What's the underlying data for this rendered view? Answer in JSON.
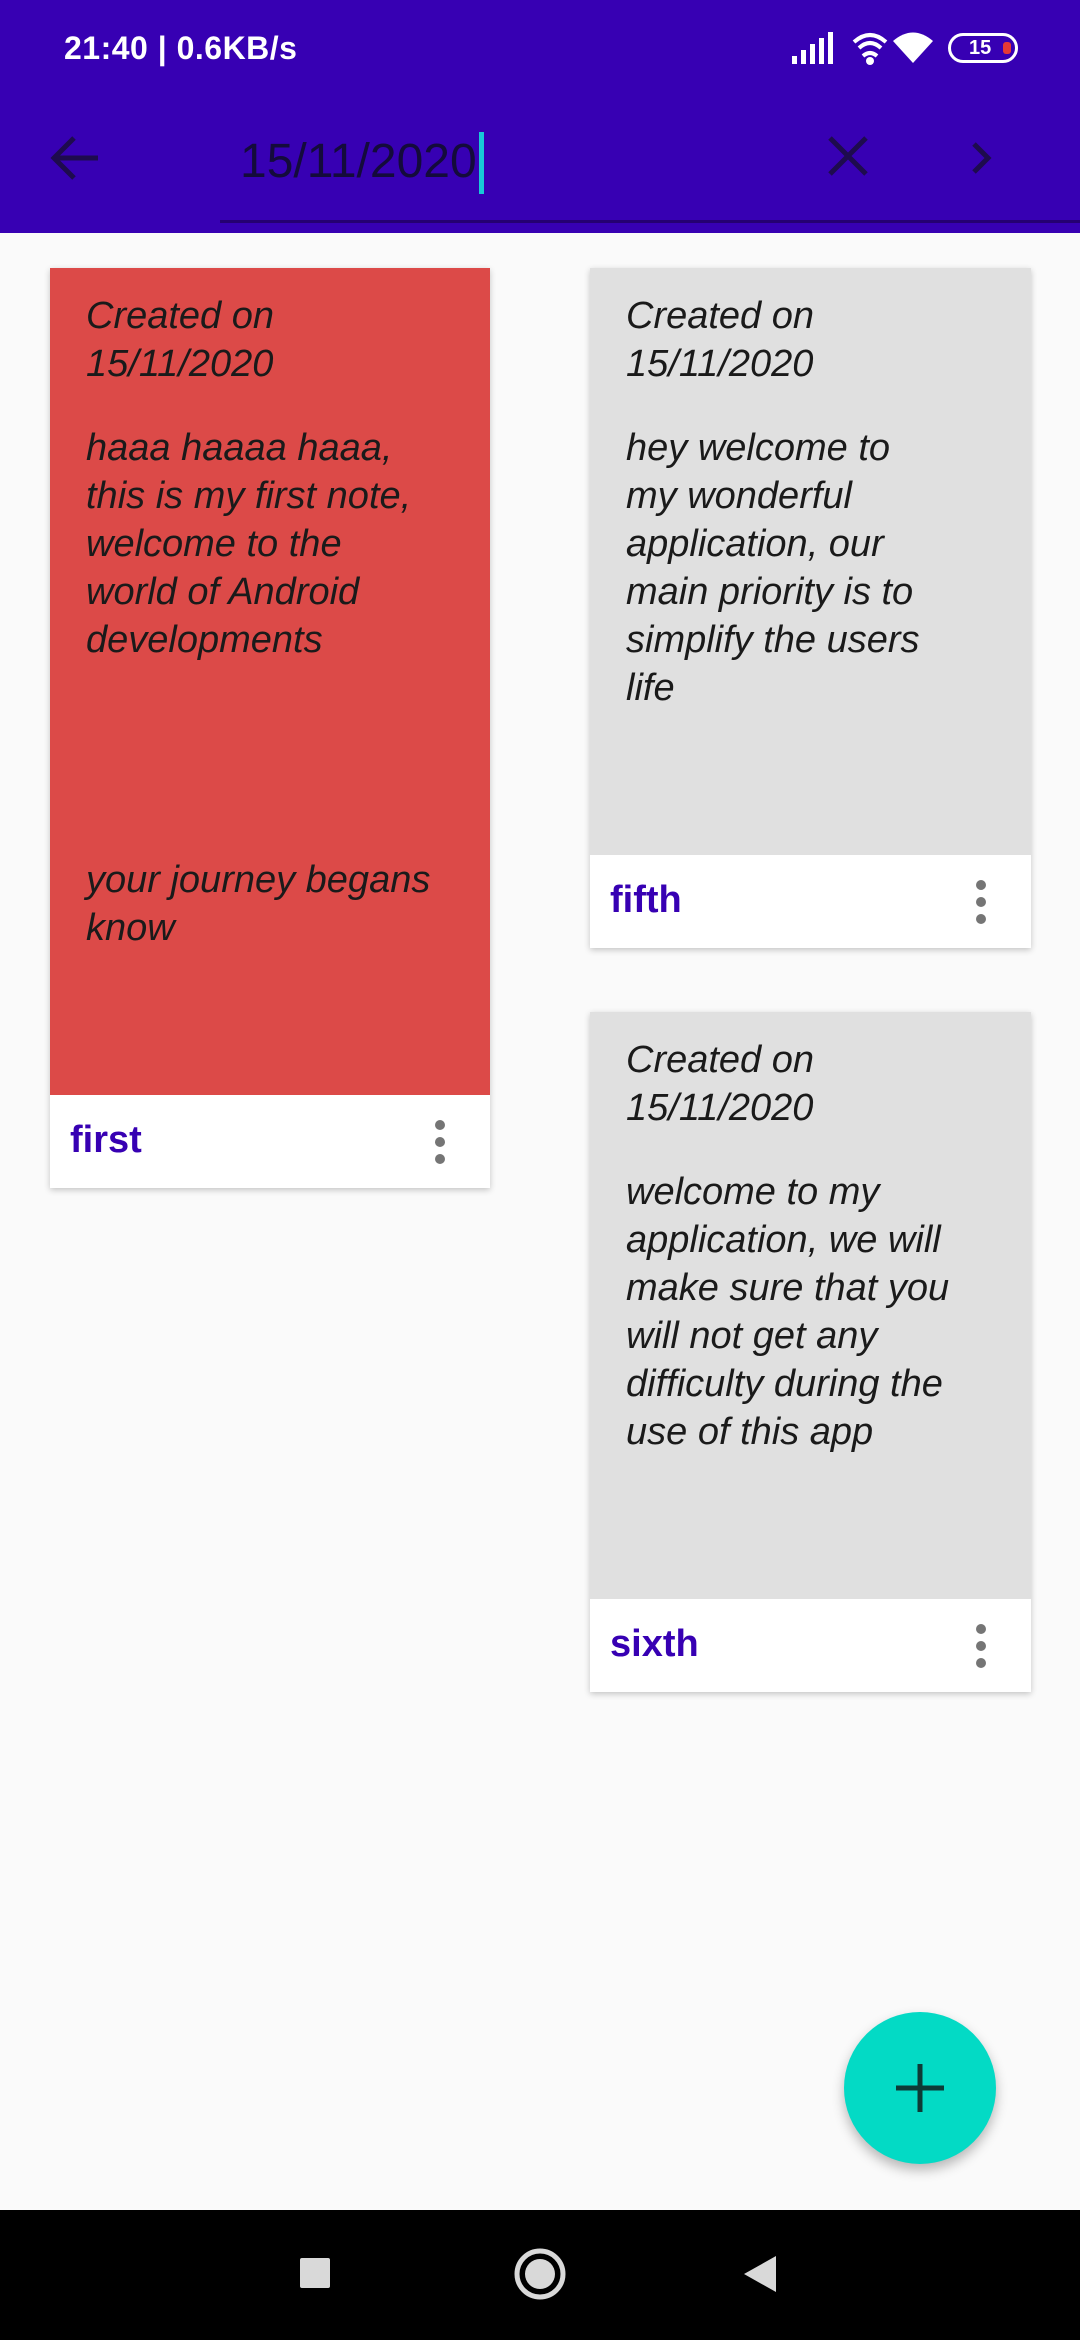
{
  "status_bar": {
    "time": "21:40 | 0.6KB/s",
    "battery_level": "15",
    "icons": [
      "signal-icon",
      "hotspot-icon",
      "wifi-icon",
      "battery-icon"
    ]
  },
  "app_bar": {
    "search_value": "15/11/2020",
    "icons": [
      "back-arrow-icon",
      "clear-icon",
      "chevron-right-icon"
    ]
  },
  "notes": [
    {
      "created": "Created on\n15/11/2020",
      "text": "haaa haaaa haaa,\nthis is my first note,\nwelcome to the\nworld of Android\ndevelopments\n\n\n\n\nyour journey begans\nknow",
      "title": "first",
      "color": "#DC4A48"
    },
    {
      "created": "Created on\n15/11/2020",
      "text": "hey welcome to\nmy wonderful\napplication, our\nmain priority is to\nsimplify the users\nlife",
      "title": "fifth",
      "color": "#E0E0E0"
    },
    {
      "created": "Created on\n15/11/2020",
      "text": "welcome to my\napplication, we will\nmake sure that you\nwill not get any\ndifficulty during the\nuse of this app",
      "title": "sixth",
      "color": "#E0E0E0"
    }
  ],
  "fab": {
    "icon": "plus-icon",
    "color": "#03DAC5"
  },
  "nav_bar": {
    "icons": [
      "recents-square-icon",
      "home-circle-icon",
      "back-triangle-icon"
    ]
  },
  "colors": {
    "primary": "#3700B3",
    "accent": "#03DAC5",
    "cursor": "#18C8D8"
  }
}
